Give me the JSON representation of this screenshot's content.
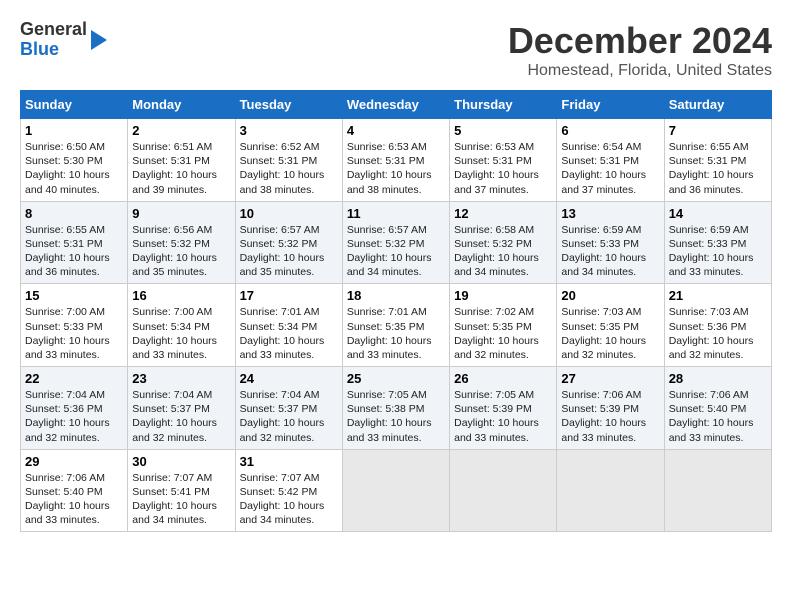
{
  "header": {
    "logo_line1": "General",
    "logo_line2": "Blue",
    "title": "December 2024",
    "subtitle": "Homestead, Florida, United States"
  },
  "calendar": {
    "days_of_week": [
      "Sunday",
      "Monday",
      "Tuesday",
      "Wednesday",
      "Thursday",
      "Friday",
      "Saturday"
    ],
    "weeks": [
      [
        {
          "day": "1",
          "sunrise": "6:50 AM",
          "sunset": "5:30 PM",
          "daylight": "10 hours and 40 minutes."
        },
        {
          "day": "2",
          "sunrise": "6:51 AM",
          "sunset": "5:31 PM",
          "daylight": "10 hours and 39 minutes."
        },
        {
          "day": "3",
          "sunrise": "6:52 AM",
          "sunset": "5:31 PM",
          "daylight": "10 hours and 38 minutes."
        },
        {
          "day": "4",
          "sunrise": "6:53 AM",
          "sunset": "5:31 PM",
          "daylight": "10 hours and 38 minutes."
        },
        {
          "day": "5",
          "sunrise": "6:53 AM",
          "sunset": "5:31 PM",
          "daylight": "10 hours and 37 minutes."
        },
        {
          "day": "6",
          "sunrise": "6:54 AM",
          "sunset": "5:31 PM",
          "daylight": "10 hours and 37 minutes."
        },
        {
          "day": "7",
          "sunrise": "6:55 AM",
          "sunset": "5:31 PM",
          "daylight": "10 hours and 36 minutes."
        }
      ],
      [
        {
          "day": "8",
          "sunrise": "6:55 AM",
          "sunset": "5:31 PM",
          "daylight": "10 hours and 36 minutes."
        },
        {
          "day": "9",
          "sunrise": "6:56 AM",
          "sunset": "5:32 PM",
          "daylight": "10 hours and 35 minutes."
        },
        {
          "day": "10",
          "sunrise": "6:57 AM",
          "sunset": "5:32 PM",
          "daylight": "10 hours and 35 minutes."
        },
        {
          "day": "11",
          "sunrise": "6:57 AM",
          "sunset": "5:32 PM",
          "daylight": "10 hours and 34 minutes."
        },
        {
          "day": "12",
          "sunrise": "6:58 AM",
          "sunset": "5:32 PM",
          "daylight": "10 hours and 34 minutes."
        },
        {
          "day": "13",
          "sunrise": "6:59 AM",
          "sunset": "5:33 PM",
          "daylight": "10 hours and 34 minutes."
        },
        {
          "day": "14",
          "sunrise": "6:59 AM",
          "sunset": "5:33 PM",
          "daylight": "10 hours and 33 minutes."
        }
      ],
      [
        {
          "day": "15",
          "sunrise": "7:00 AM",
          "sunset": "5:33 PM",
          "daylight": "10 hours and 33 minutes."
        },
        {
          "day": "16",
          "sunrise": "7:00 AM",
          "sunset": "5:34 PM",
          "daylight": "10 hours and 33 minutes."
        },
        {
          "day": "17",
          "sunrise": "7:01 AM",
          "sunset": "5:34 PM",
          "daylight": "10 hours and 33 minutes."
        },
        {
          "day": "18",
          "sunrise": "7:01 AM",
          "sunset": "5:35 PM",
          "daylight": "10 hours and 33 minutes."
        },
        {
          "day": "19",
          "sunrise": "7:02 AM",
          "sunset": "5:35 PM",
          "daylight": "10 hours and 32 minutes."
        },
        {
          "day": "20",
          "sunrise": "7:03 AM",
          "sunset": "5:35 PM",
          "daylight": "10 hours and 32 minutes."
        },
        {
          "day": "21",
          "sunrise": "7:03 AM",
          "sunset": "5:36 PM",
          "daylight": "10 hours and 32 minutes."
        }
      ],
      [
        {
          "day": "22",
          "sunrise": "7:04 AM",
          "sunset": "5:36 PM",
          "daylight": "10 hours and 32 minutes."
        },
        {
          "day": "23",
          "sunrise": "7:04 AM",
          "sunset": "5:37 PM",
          "daylight": "10 hours and 32 minutes."
        },
        {
          "day": "24",
          "sunrise": "7:04 AM",
          "sunset": "5:37 PM",
          "daylight": "10 hours and 32 minutes."
        },
        {
          "day": "25",
          "sunrise": "7:05 AM",
          "sunset": "5:38 PM",
          "daylight": "10 hours and 33 minutes."
        },
        {
          "day": "26",
          "sunrise": "7:05 AM",
          "sunset": "5:39 PM",
          "daylight": "10 hours and 33 minutes."
        },
        {
          "day": "27",
          "sunrise": "7:06 AM",
          "sunset": "5:39 PM",
          "daylight": "10 hours and 33 minutes."
        },
        {
          "day": "28",
          "sunrise": "7:06 AM",
          "sunset": "5:40 PM",
          "daylight": "10 hours and 33 minutes."
        }
      ],
      [
        {
          "day": "29",
          "sunrise": "7:06 AM",
          "sunset": "5:40 PM",
          "daylight": "10 hours and 33 minutes."
        },
        {
          "day": "30",
          "sunrise": "7:07 AM",
          "sunset": "5:41 PM",
          "daylight": "10 hours and 34 minutes."
        },
        {
          "day": "31",
          "sunrise": "7:07 AM",
          "sunset": "5:42 PM",
          "daylight": "10 hours and 34 minutes."
        },
        null,
        null,
        null,
        null
      ]
    ]
  }
}
